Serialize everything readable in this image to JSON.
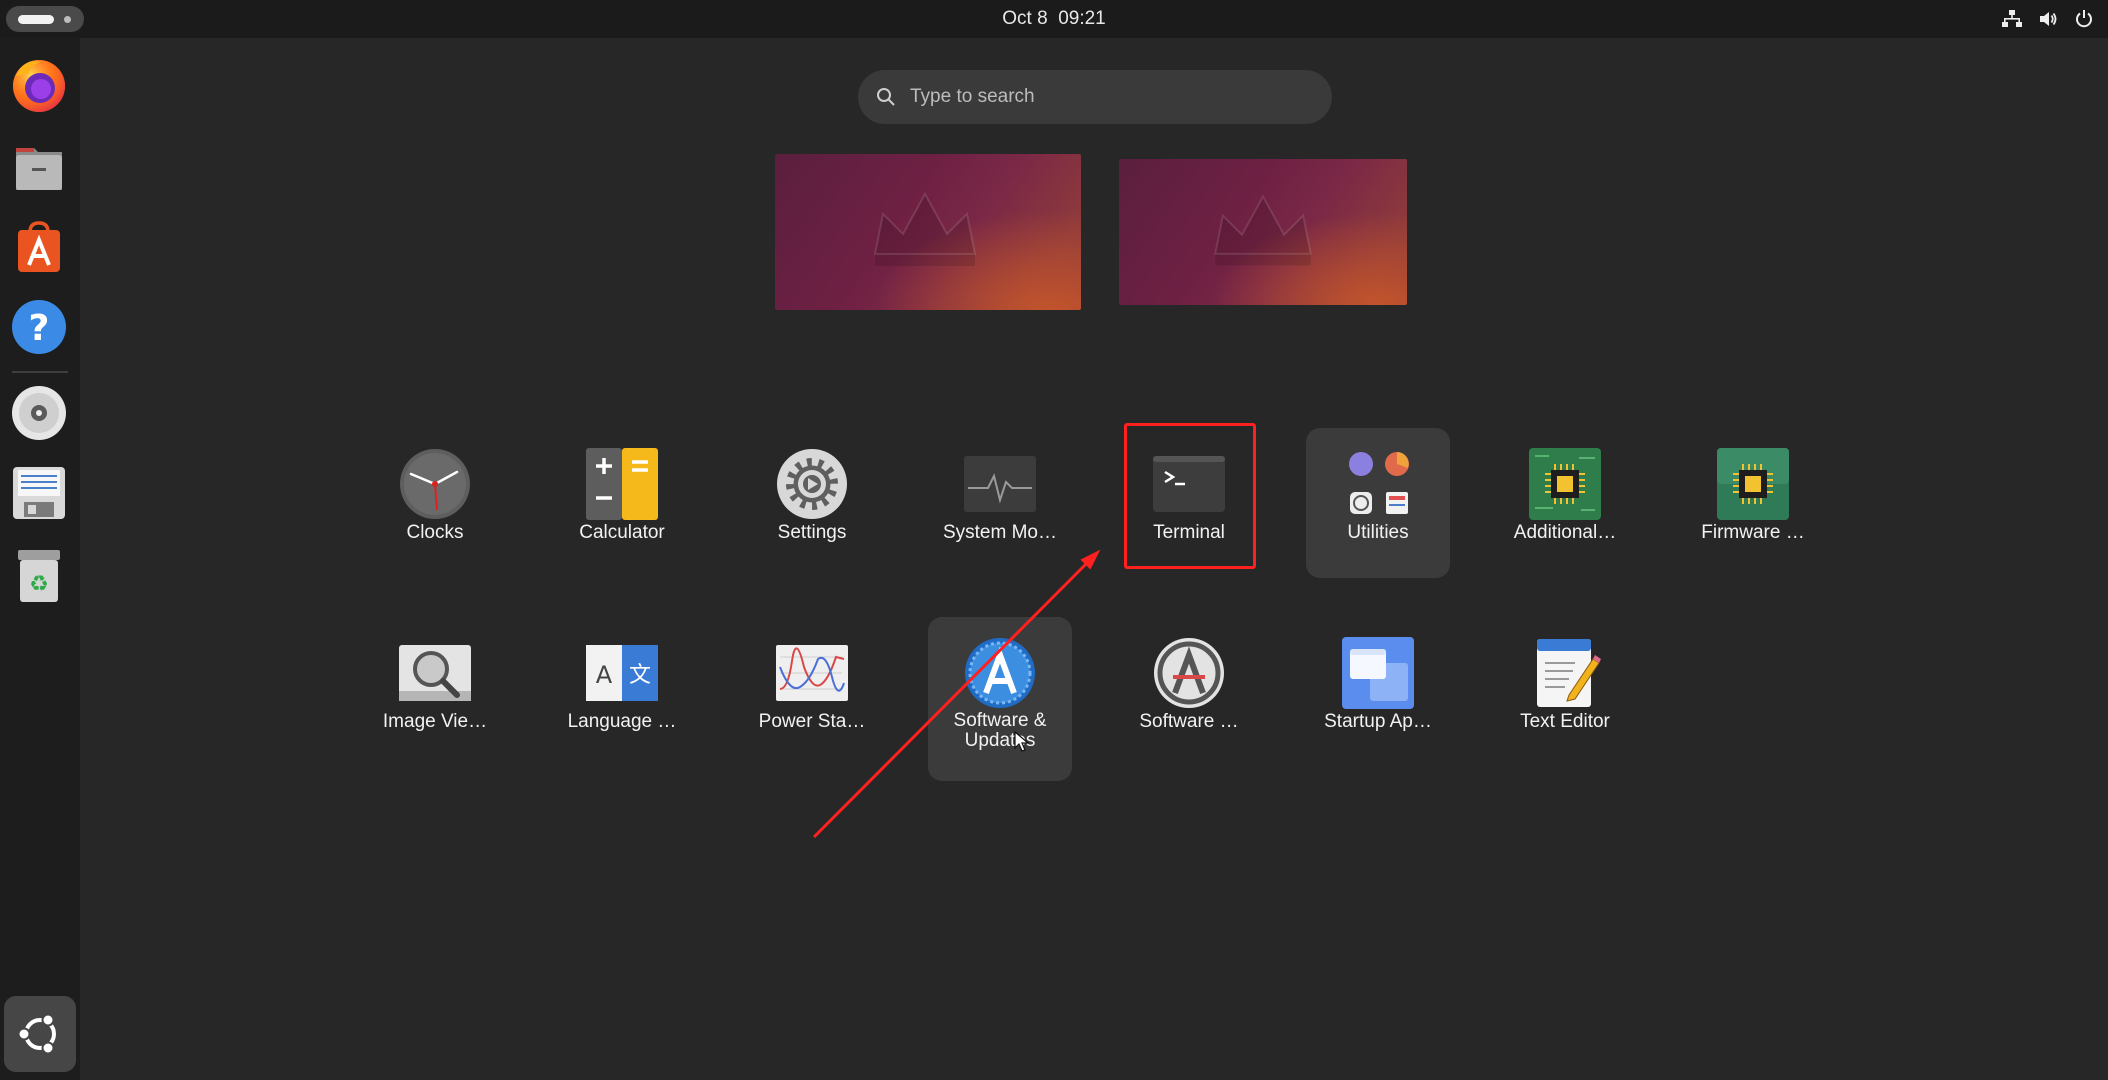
{
  "topbar": {
    "date": "Oct 8",
    "time": "09:21",
    "tray_icons": [
      "network-icon",
      "volume-icon",
      "power-icon"
    ]
  },
  "dock": {
    "items": [
      {
        "name": "Firefox",
        "icon": "firefox-icon"
      },
      {
        "name": "Files",
        "icon": "files-icon"
      },
      {
        "name": "App Center",
        "icon": "app-center-icon"
      },
      {
        "name": "Help",
        "icon": "help-icon"
      },
      {
        "name": "Disc",
        "icon": "disc-icon"
      },
      {
        "name": "Save",
        "icon": "floppy-icon"
      },
      {
        "name": "Trash",
        "icon": "trash-icon"
      }
    ],
    "show_apps_icon": "ubuntu-logo-icon"
  },
  "search": {
    "placeholder": "Type to search",
    "value": ""
  },
  "apps": {
    "row1": [
      {
        "label": "Clocks",
        "icon": "clock-icon"
      },
      {
        "label": "Calculator",
        "icon": "calculator-icon"
      },
      {
        "label": "Settings",
        "icon": "settings-gear-icon"
      },
      {
        "label": "System Mo…",
        "icon": "system-monitor-icon"
      },
      {
        "label": "Terminal",
        "icon": "terminal-icon"
      },
      {
        "label": "Utilities",
        "icon": "folder-utilities-icon"
      },
      {
        "label": "Additional…",
        "icon": "chip-icon"
      },
      {
        "label": "Firmware …",
        "icon": "firmware-chip-icon"
      }
    ],
    "row2": [
      {
        "label": "Image Vie…",
        "icon": "image-viewer-icon"
      },
      {
        "label": "Language …",
        "icon": "language-icon"
      },
      {
        "label": "Power Sta…",
        "icon": "power-stats-icon"
      },
      {
        "label": "Software & Updates",
        "icon": "software-updates-icon"
      },
      {
        "label": "Software …",
        "icon": "software-properties-icon"
      },
      {
        "label": "Startup Ap…",
        "icon": "startup-apps-icon"
      },
      {
        "label": "Text Editor",
        "icon": "text-editor-icon"
      }
    ]
  },
  "colors": {
    "background": "#272727",
    "annotation": "#ff2020",
    "accent_orange": "#e95420"
  }
}
